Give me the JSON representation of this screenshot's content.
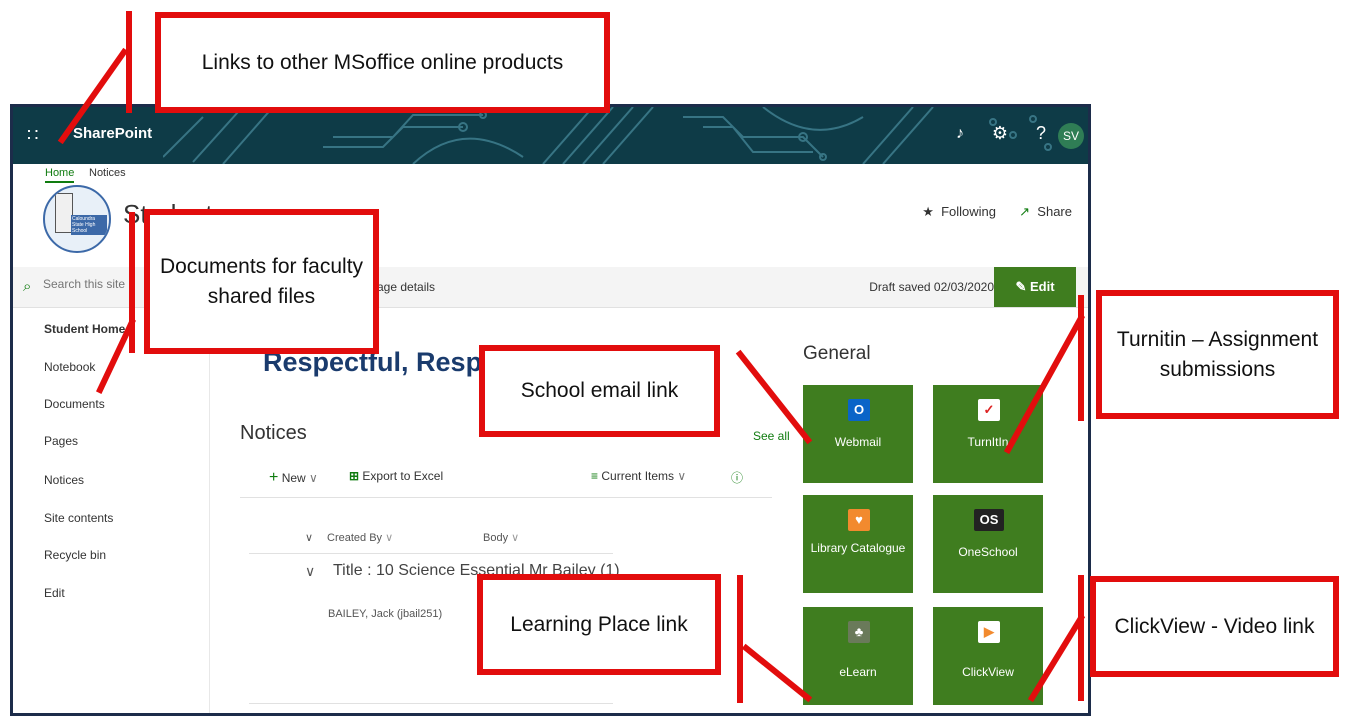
{
  "suite": {
    "brand": "SharePoint",
    "avatar_initials": "SV",
    "colors": {
      "bar": "#0e3b47",
      "accent": "#3f7d1f",
      "callout": "#e20d0d"
    }
  },
  "breadcrumb": {
    "home": "Home",
    "notices": "Notices"
  },
  "site": {
    "title": "Students",
    "logo_text": "Caloundra State High School"
  },
  "header_actions": {
    "following": "Following",
    "share": "Share"
  },
  "commandbar": {
    "search_placeholder": "Search this site",
    "details": "Page details",
    "draft": "Draft saved 02/03/2020",
    "edit": "Edit"
  },
  "nav": [
    {
      "label": "Student Home"
    },
    {
      "label": "Notebook"
    },
    {
      "label": "Documents"
    },
    {
      "label": "Pages"
    },
    {
      "label": "Notices"
    },
    {
      "label": "Site contents"
    },
    {
      "label": "Recycle bin"
    },
    {
      "label": "Edit"
    }
  ],
  "banner": "Respectful, Responsible, Prepared",
  "general": {
    "title": "General",
    "tiles": [
      {
        "label": "Webmail",
        "icon": "outlook-icon"
      },
      {
        "label": "TurnItIn",
        "icon": "turnitin-icon"
      },
      {
        "label": "Library Catalogue",
        "icon": "library-icon"
      },
      {
        "label": "OneSchool",
        "icon": "oneschool-icon"
      },
      {
        "label": "eLearn",
        "icon": "elearn-icon"
      },
      {
        "label": "ClickView",
        "icon": "clickview-icon"
      }
    ]
  },
  "notices": {
    "title": "Notices",
    "see_all": "See all",
    "new": "New",
    "export": "Export to Excel",
    "view": "Current Items",
    "columns": {
      "created_by": "Created By",
      "body": "Body"
    },
    "rows": [
      {
        "title": "Title : 10 Science Essential Mr Bailey (1)",
        "creator": "BAILEY, Jack (jbail251)"
      }
    ]
  },
  "callouts": [
    {
      "text": "Links to other MSoffice online products"
    },
    {
      "text": "Documents for faculty shared files"
    },
    {
      "text": "School email link"
    },
    {
      "text": "Turnitin – Assignment submissions"
    },
    {
      "text": "Learning Place link"
    },
    {
      "text": "ClickView - Video link"
    }
  ]
}
